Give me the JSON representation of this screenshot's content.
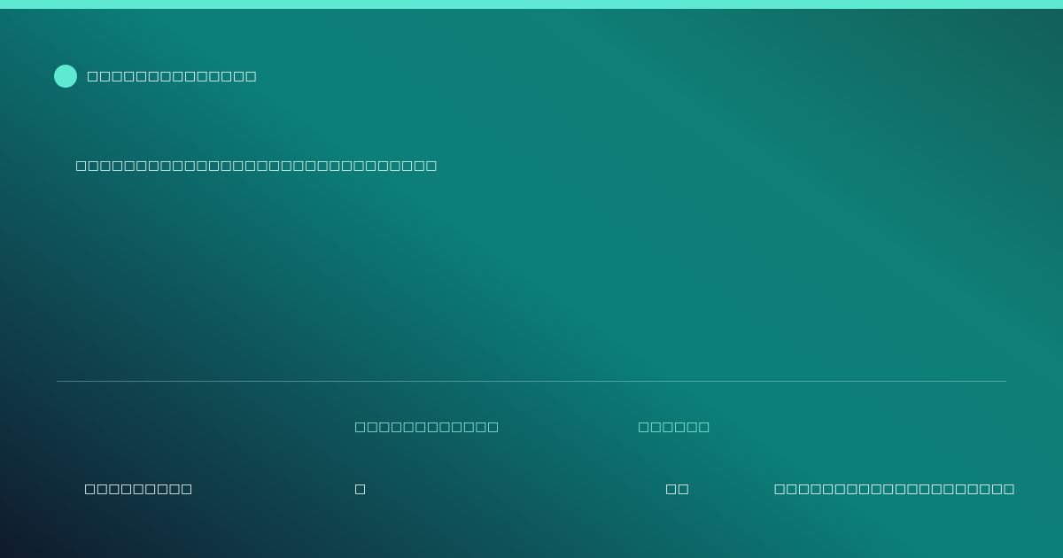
{
  "colors": {
    "accent": "#5ee9d2",
    "background_dark": "#0f1a2c",
    "background_teal": "#0b7f78",
    "label_text": "#8ff0df",
    "body_text": "#ffffff"
  },
  "brand": {
    "icon": "brand-dot-icon",
    "name": "□□□□□□□□□□□□□□"
  },
  "headline": "□□□□□□□□□□□□□□□□□□□□□□□□□□□□□□",
  "footer": {
    "labels": {
      "a": "□□□□□□□□□□□□",
      "b": "□□□□□□"
    },
    "values": {
      "left": "□□□□□□□□□",
      "a": "□",
      "b": "□□",
      "right": "□□□□□□□□□□□□□□□□□□□□"
    }
  }
}
